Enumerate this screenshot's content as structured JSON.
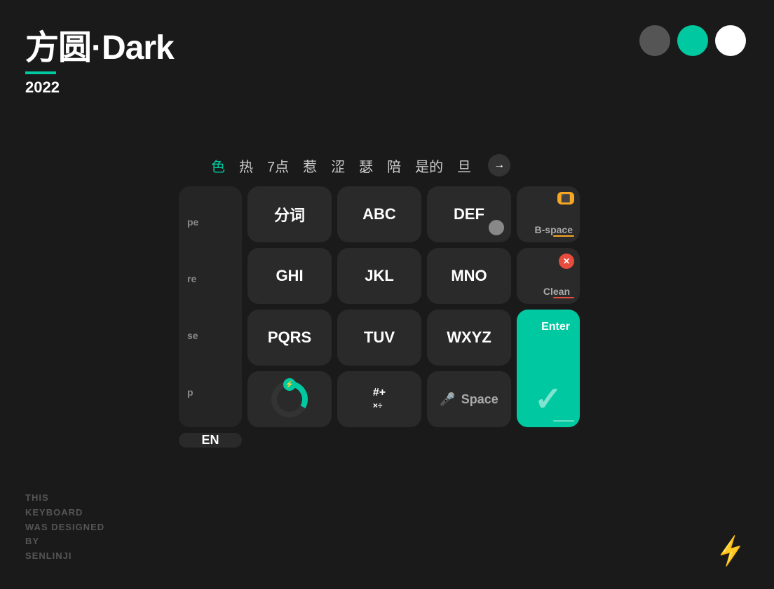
{
  "header": {
    "title": "方圆·Dark",
    "year": "2022"
  },
  "circles": [
    {
      "color": "dark",
      "label": "dark-circle"
    },
    {
      "color": "teal",
      "label": "teal-circle"
    },
    {
      "color": "white",
      "label": "white-circle"
    }
  ],
  "suggestions": {
    "items": [
      "色",
      "热",
      "7点",
      "惹",
      "涩",
      "瑟",
      "陪",
      "是的",
      "旦"
    ],
    "active_index": 0,
    "arrow_label": "→"
  },
  "sidebar": {
    "items": [
      "pe",
      "re",
      "se",
      "p"
    ]
  },
  "keys": {
    "row1": [
      "分词",
      "ABC",
      "DEF"
    ],
    "row2": [
      "GHI",
      "JKL",
      "MNO"
    ],
    "row3": [
      "PQRS",
      "TUV",
      "WXYZ"
    ],
    "bspace_label": "B-space",
    "clean_label": "Clean",
    "enter_label": "Enter",
    "symbol_label": "#+",
    "space_label": "Space",
    "lang_label": "EN"
  },
  "bottom_text": "THIS\nKEYBOARD\nWAS DESIGNED\nBY\nSENLINJI",
  "colors": {
    "teal": "#00c8a0",
    "red": "#e74c3c",
    "orange": "#f5a623",
    "bg": "#1a1a1a",
    "key_bg": "#2a2a2a"
  }
}
